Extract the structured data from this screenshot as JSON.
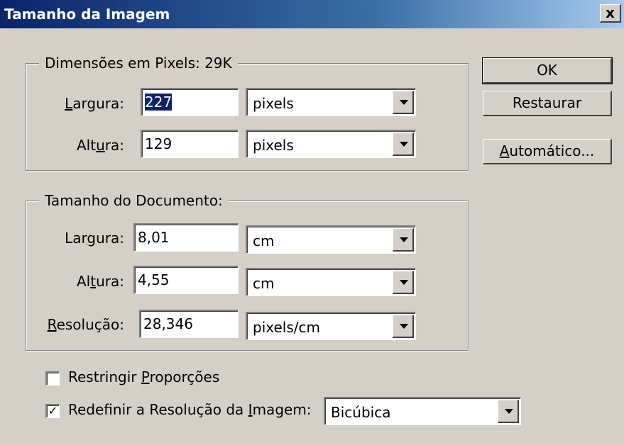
{
  "window": {
    "title": "Tamanho da Imagem",
    "close_glyph": "x"
  },
  "pixel_dimensions": {
    "legend": "Dimensões em Pixels:  29K",
    "width_label_pre": "",
    "width_label_u": "L",
    "width_label_post": "argura:",
    "width_value": "227",
    "width_unit": "pixels",
    "height_label_pre": "Alt",
    "height_label_u": "u",
    "height_label_post": "ra:",
    "height_value": "129",
    "height_unit": "pixels"
  },
  "document_size": {
    "legend": "Tamanho do Documento:",
    "width_label_pre": "Lar",
    "width_label_u": "g",
    "width_label_post": "ura:",
    "width_value": "8,01",
    "width_unit": "cm",
    "height_label_pre": "Al",
    "height_label_u": "t",
    "height_label_post": "ura:",
    "height_value": "4,55",
    "height_unit": "cm",
    "resolution_label_pre": "",
    "resolution_label_u": "R",
    "resolution_label_post": "esolução:",
    "resolution_value": "28,346",
    "resolution_unit": "pixels/cm"
  },
  "options": {
    "constrain_pre": "Restringir ",
    "constrain_u": "P",
    "constrain_post": "roporções",
    "constrain_checked": false,
    "resample_pre": "Redefinir a Resolução da ",
    "resample_u": "I",
    "resample_post": "magem:",
    "resample_checked": true,
    "resample_method": "Bicúbica",
    "check_glyph": "✓"
  },
  "buttons": {
    "ok": "OK",
    "reset": "Restaurar",
    "auto_u": "A",
    "auto_post": "utomático..."
  }
}
